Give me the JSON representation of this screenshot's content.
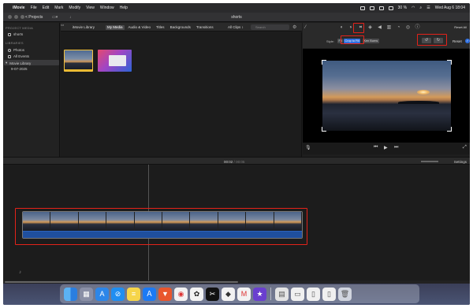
{
  "menubar": {
    "app_name": "iMovie",
    "menus": [
      "File",
      "Edit",
      "Mark",
      "Modify",
      "View",
      "Window",
      "Help"
    ],
    "battery": "30 %",
    "datetime": "Wed Aug 6  18:04"
  },
  "toolbar": {
    "projects_label": "< Projects",
    "window_title": "shorts"
  },
  "sidebar": {
    "project_media_header": "PROJECT MEDIA",
    "project_item": "shorts",
    "libraries_header": "LIBRARIES",
    "library_items": [
      "Photos",
      "All Events",
      "Movie Library"
    ],
    "event_item": "9-07-2025"
  },
  "browser": {
    "library_title": "iMovie Library",
    "tabs": [
      "My Media",
      "Audio & Video",
      "Titles",
      "Backgrounds",
      "Transitions"
    ],
    "active_tab_index": 0,
    "filter_label": "All Clips ↕",
    "search_placeholder": "Search"
  },
  "viewer": {
    "reset_all_label": "Reset All",
    "style_label": "Style:",
    "style_options": [
      "Fit",
      "Crop to Fill",
      "Ken Burns"
    ],
    "active_style_index": 1,
    "rotate_left_label": "↺",
    "rotate_right_label": "↻",
    "reset_label": "Reset",
    "apply_label": "✓"
  },
  "timeline": {
    "current_time": "00:02",
    "total_time": "00:05",
    "settings_label": "Settings"
  },
  "dock": {
    "apps": [
      "finder",
      "launchpad",
      "app-store",
      "safari",
      "notes",
      "app-store-a",
      "brave",
      "chrome",
      "openai",
      "capcut",
      "roblox",
      "gmail",
      "imovie",
      "preview",
      "files",
      "document",
      "pages",
      "trash"
    ]
  },
  "colors": {
    "accent_blue": "#2f6fe0",
    "annotation_red": "#e3221a",
    "audio_track": "#1f4f9e",
    "selected_clip": "#f3c23d"
  }
}
